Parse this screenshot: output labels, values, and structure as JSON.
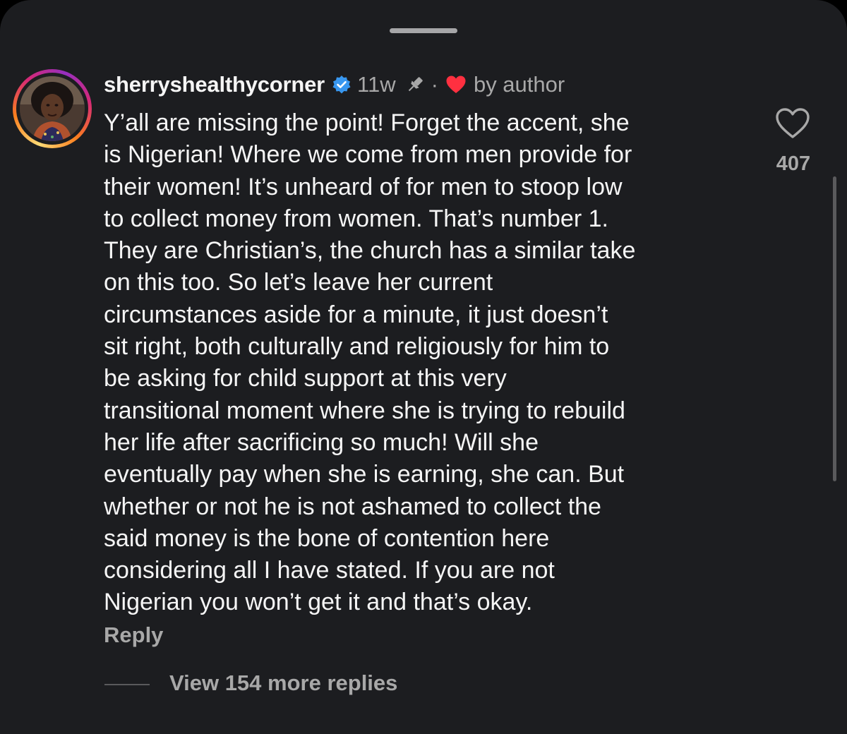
{
  "comment": {
    "username": "sherryshealthycorner",
    "verified_icon": "verified-badge-icon",
    "age": "11w",
    "pinned_icon": "pin-icon",
    "separator": "·",
    "liked_by_author_icon": "red-heart-icon",
    "liked_by_label": "by author",
    "text_lines": [
      "Y’all are missing the point! Forget the accent, she",
      "is Nigerian! Where we come from men provide for",
      "their women! It’s unheard of for men to stoop low",
      "to collect money from women. That’s number 1.",
      "They are Christian’s, the church has a similar take",
      "on this too. So let’s leave her current",
      "circumstances aside for a minute, it just doesn’t",
      "sit right, both culturally and religiously for him to",
      "be asking for child support at this very",
      "transitional moment where she is trying to rebuild",
      "her life after sacrificing so much! Will she",
      "eventually pay when she is earning, she can. But",
      "whether or not he is not ashamed to collect the",
      "said money is the bone of contention here",
      "considering all I have stated. If you are not",
      "Nigerian you won’t get it and that’s okay."
    ],
    "like_icon": "heart-outline-icon",
    "like_count": "407",
    "reply_label": "Reply",
    "view_replies_label": "View 154 more replies"
  },
  "colors": {
    "background": "#1c1d20",
    "primary_text": "#f5f5f5",
    "secondary_text": "#a8a8a8",
    "verified_blue": "#3897f0",
    "heart_red": "#ff3040"
  }
}
